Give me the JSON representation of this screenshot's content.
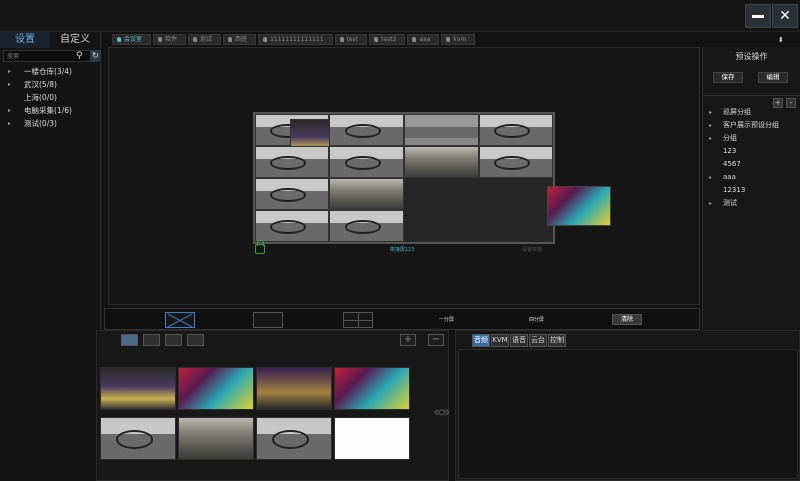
{
  "left_panel": {
    "tabs": [
      "设置",
      "自定义"
    ],
    "search_placeholder": "搜索",
    "tree": [
      {
        "label": "一楼仓库(3/4)",
        "expandable": true
      },
      {
        "label": "武汉(5/8)",
        "expandable": true
      },
      {
        "label": "上海(0/0)",
        "expandable": false
      },
      {
        "label": "电脑采集(1/6)",
        "expandable": true
      },
      {
        "label": "测试(0/3)",
        "expandable": true
      }
    ]
  },
  "top_tabs": [
    "会议室",
    "软件",
    "测试",
    "西班",
    "11111111111111",
    "test",
    "test2",
    "aaa",
    "kvm"
  ],
  "active_tab_index": 0,
  "canvas": {
    "wall_label": "拼接屏123",
    "wall_label_right": "设置拼接"
  },
  "layout_bar": {
    "labels": [
      "一分屏",
      "四分屏"
    ],
    "clear_label": "清除"
  },
  "right_panel": {
    "title": "预设操作",
    "save_label": "保存",
    "edit_label": "编辑",
    "plus": "+",
    "minus": "-",
    "items": [
      {
        "label": "巡屏分组",
        "expandable": true
      },
      {
        "label": "客户展示预设分组",
        "expandable": true
      },
      {
        "label": "分组",
        "expandable": true
      },
      {
        "label": "123",
        "expandable": false
      },
      {
        "label": "4567",
        "expandable": false
      },
      {
        "label": "aaa",
        "expandable": true
      },
      {
        "label": "12313",
        "expandable": false
      },
      {
        "label": "测试",
        "expandable": true
      }
    ]
  },
  "bottom_left": {
    "view_buttons": [
      "",
      "",
      "",
      ""
    ],
    "add_label": "+",
    "remove_label": "−"
  },
  "bottom_right": {
    "tabs": [
      "音频",
      "KVM",
      "语音",
      "云台",
      "控制"
    ],
    "active_tab_index": 0
  },
  "nav_arrows": "«»",
  "colors": {
    "accent": "#3a6ea8",
    "tab_active": "#5fb7d8",
    "lock_green": "#3c9a3c"
  }
}
